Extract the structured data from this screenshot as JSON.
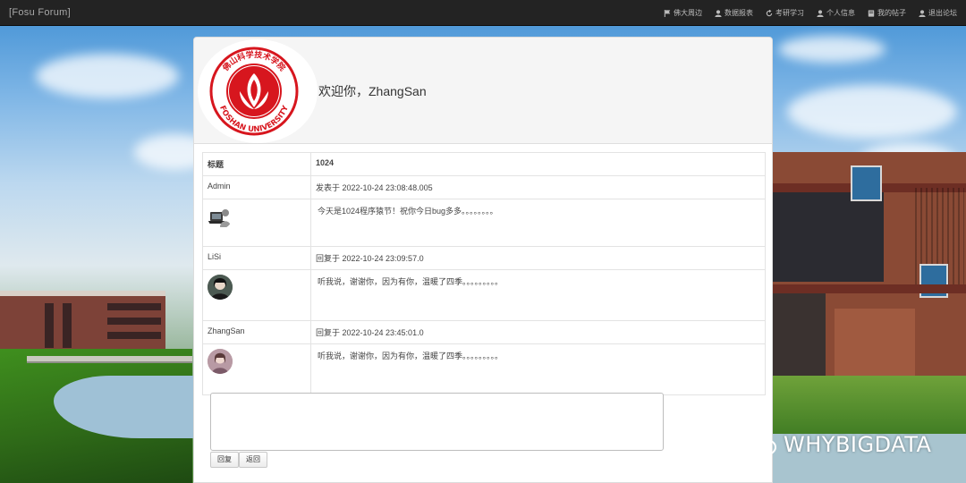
{
  "brand": "[Fosu Forum]",
  "nav": [
    {
      "label": "佛大周边",
      "icon": "flag-icon"
    },
    {
      "label": "数据报表",
      "icon": "user-icon"
    },
    {
      "label": "考研学习",
      "icon": "refresh-icon"
    },
    {
      "label": "个人信息",
      "icon": "user-icon"
    },
    {
      "label": "我的帖子",
      "icon": "book-icon"
    },
    {
      "label": "退出论坛",
      "icon": "user-icon"
    }
  ],
  "logo": {
    "text_top": "佛山科学技术学院",
    "text_bottom": "FOSHAN UNIVERSITY",
    "color": "#d7161e"
  },
  "welcome": "欢迎你，ZhangSan",
  "thread": {
    "title_label": "标题",
    "title": "1024",
    "posts": [
      {
        "author": "Admin",
        "meta": "发表于  2022-10-24 23:08:48.005",
        "content": " 今天是1024程序猿节！祝你今日bug多多。。。。。。。。"
      },
      {
        "author": "LiSi",
        "meta": "回复于  2022-10-24 23:09:57.0",
        "content": " 听我说，谢谢你，因为有你，温暖了四季。。。。。。。。。"
      },
      {
        "author": "ZhangSan",
        "meta": "回复于  2022-10-24 23:45:01.0",
        "content": "  听我说，谢谢你，因为有你，温暖了四季。。。。。。。。。"
      }
    ]
  },
  "reply": {
    "value": "",
    "submit_label": "回复",
    "back_label": "返回"
  },
  "watermark": "WHYBIGDATA"
}
